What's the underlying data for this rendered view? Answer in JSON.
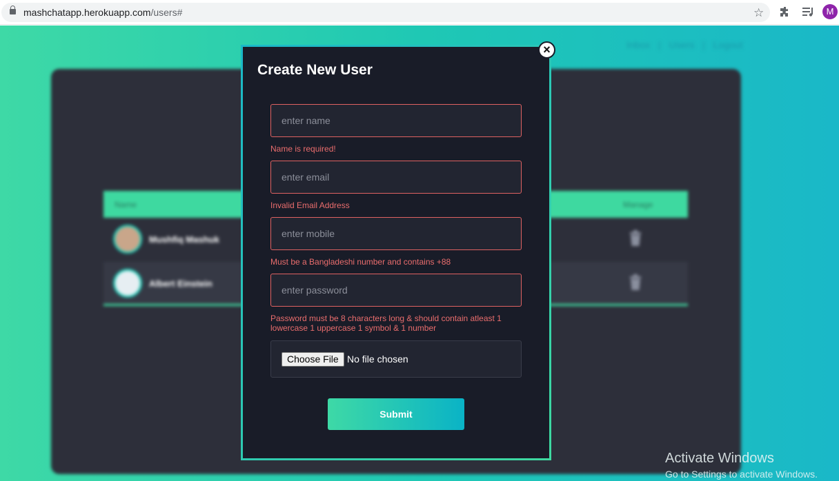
{
  "browser": {
    "url_host": "mashchatapp.herokuapp.com",
    "url_path": "/users#",
    "profile_initial": "M",
    "icons": [
      "lock-icon",
      "star-icon",
      "extensions-icon",
      "media-queue-icon"
    ]
  },
  "nav": {
    "inbox": "Inbox",
    "users": "Users",
    "logout": "Logout",
    "separator": "|"
  },
  "table": {
    "headers": {
      "name": "Name",
      "manage": "Manage"
    },
    "rows": [
      {
        "name": "Mushfiq Mashuk"
      },
      {
        "name": "Albert Einstein"
      }
    ]
  },
  "modal": {
    "title": "Create New User",
    "close_label": "×",
    "name": {
      "placeholder": "enter name",
      "error": "Name is required!"
    },
    "email": {
      "placeholder": "enter email",
      "error": "Invalid Email Address"
    },
    "mobile": {
      "placeholder": "enter mobile",
      "error": "Must be a Bangladeshi number and contains +88"
    },
    "password": {
      "placeholder": "enter password",
      "error": "Password must be 8 characters long & should contain atleast 1 lowercase 1 uppercase 1 symbol & 1 number"
    },
    "file": {
      "button": "Choose File",
      "status": "No file chosen"
    },
    "submit_label": "Submit"
  },
  "watermark": {
    "line1": "Activate Windows",
    "line2": "Go to Settings to activate Windows."
  },
  "colors": {
    "accent_green": "#3ed9a0",
    "accent_teal": "#1ab8c8",
    "modal_bg": "#191c28",
    "error": "#ea6d6d"
  }
}
